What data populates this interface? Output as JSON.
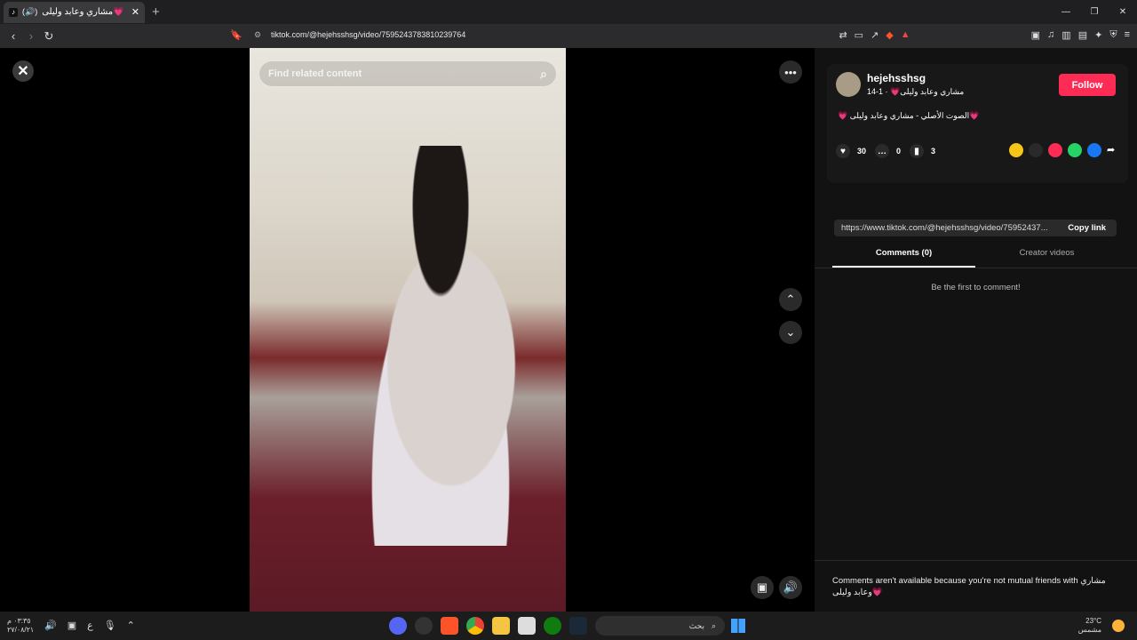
{
  "browser": {
    "tab_title": "مشاري وعابد وليلى💗",
    "tab_audio_label": "(🔊)",
    "url": "tiktok.com/@hejehsshsg/video/7595243783810239764"
  },
  "video": {
    "search_placeholder": "Find related content"
  },
  "author": {
    "username": "hejehsshsg",
    "nickname": "مشاري وعابد وليلى💗 · 1-14",
    "description": "💗 الصوت الأصلي - مشاري وعابد وليلى💗",
    "follow_label": "Follow",
    "likes": "30",
    "comments": "0",
    "saves": "3"
  },
  "share": {
    "link": "https://www.tiktok.com/@hejehsshsg/video/75952437...",
    "copy_label": "Copy link",
    "icon_colors": [
      "#f5c518",
      "#2a2a2a",
      "#fe2c55",
      "#25d366",
      "#1877f2"
    ]
  },
  "comments": {
    "tabs": [
      "Comments (0)",
      "Creator videos"
    ],
    "empty_text": "Be the first to comment!",
    "notice": "Comments aren't available because you're not mutual friends with مشاري وعابد وليلى💗"
  },
  "taskbar": {
    "search_label": "بحث",
    "time": "٠٣:٣٥ م",
    "date": "٢٧/٠٨/٢١",
    "weather": "23°C",
    "weather_desc": "مشمس",
    "lang": "ع"
  }
}
